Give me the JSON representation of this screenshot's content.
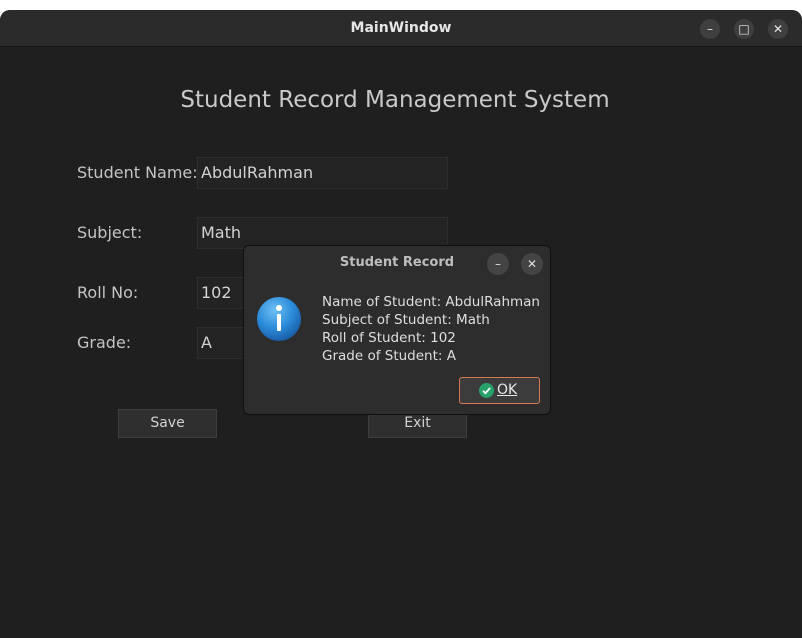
{
  "window": {
    "title": "MainWindow",
    "controls": {
      "minimize": "–",
      "maximize": "□",
      "close": "✕"
    }
  },
  "form": {
    "heading": "Student Record Management System",
    "fields": [
      {
        "label": "Student Name:",
        "value": "AbdulRahman"
      },
      {
        "label": "Subject:",
        "value": "Math"
      },
      {
        "label": "Roll No:",
        "value": "102"
      },
      {
        "label": "Grade:",
        "value": "A"
      }
    ],
    "buttons": {
      "save": "Save",
      "exit": "Exit"
    }
  },
  "dialog": {
    "title": "Student Record",
    "controls": {
      "minimize": "–",
      "close": "✕"
    },
    "icon": "information-icon",
    "lines": [
      "Name of Student: AbdulRahman",
      "Subject of Student: Math",
      "Roll of Student: 102",
      "Grade of Student: A"
    ],
    "ok_label": "OK"
  },
  "colors": {
    "window_bg": "#1f1f1f",
    "titlebar_bg": "#2b2b2b",
    "dialog_bg": "#2d2d2d",
    "accent_border": "#d7794f",
    "check_green": "#26a269",
    "info_blue": "#2a8ad8"
  }
}
